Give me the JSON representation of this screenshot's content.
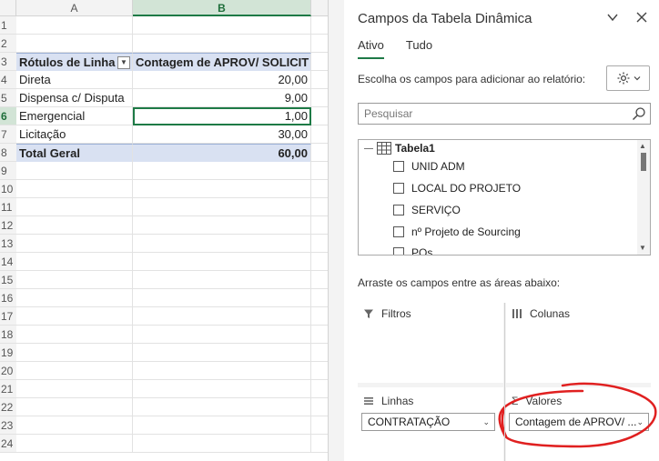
{
  "sheet": {
    "columns": [
      "A",
      "B"
    ],
    "row_numbers": [
      "1",
      "2",
      "3",
      "4",
      "5",
      "6",
      "7",
      "8",
      "9",
      "10",
      "11",
      "12",
      "13",
      "14",
      "15",
      "16",
      "17",
      "18",
      "19",
      "20",
      "21",
      "22",
      "23",
      "24"
    ],
    "active_row": "6",
    "pivot": {
      "header_rows": "Rótulos de Linha",
      "header_values": "Contagem de APROV/ SOLICIT",
      "rows": [
        {
          "label": "Direta",
          "value": "20,00"
        },
        {
          "label": "Dispensa c/ Disputa",
          "value": "9,00"
        },
        {
          "label": "Emergencial",
          "value": "1,00"
        },
        {
          "label": "Licitação",
          "value": "30,00"
        }
      ],
      "total_label": "Total Geral",
      "total_value": "60,00"
    }
  },
  "panel": {
    "title": "Campos da Tabela Dinâmica",
    "tabs": [
      "Ativo",
      "Tudo"
    ],
    "choose_label": "Escolha os campos para adicionar ao relatório:",
    "search_placeholder": "Pesquisar",
    "table_name": "Tabela1",
    "fields": [
      "UNID ADM",
      "LOCAL DO PROJETO",
      "SERVIÇO",
      "nº Projeto de Sourcing",
      "POs"
    ],
    "drag_label": "Arraste os campos entre as áreas abaixo:",
    "areas": {
      "filters": "Filtros",
      "columns": "Colunas",
      "rows": "Linhas",
      "values": "Valores"
    },
    "rows_field": "CONTRATAÇÃO",
    "values_field": "Contagem de APROV/ ...",
    "icons": {
      "dropdown": "chevron-down-icon",
      "close": "close-icon",
      "gear": "gear-icon",
      "search": "search-icon",
      "table": "table-icon",
      "filter": "filter-icon",
      "columns": "columns-icon",
      "rows": "rows-icon",
      "sigma": "sigma-icon"
    },
    "accent_color": "#1e7a46",
    "annotation_color": "#e02020"
  }
}
